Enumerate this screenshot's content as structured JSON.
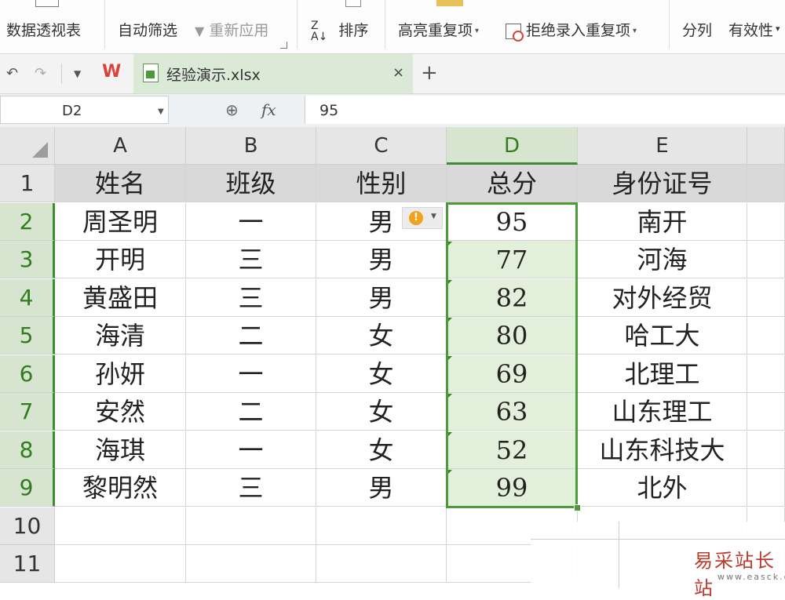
{
  "ribbon": {
    "pivot_table": "数据透视表",
    "autofilter": "自动筛选",
    "reapply": "重新应用",
    "sort": "排序",
    "highlight_dupes": "高亮重复项",
    "reject_dupes": "拒绝录入重复项",
    "split_columns": "分列",
    "validity": "有效性"
  },
  "tabs": [
    {
      "label": "经验演示.xlsx",
      "active": true
    }
  ],
  "formula_bar": {
    "name_box": "D2",
    "fx_label": "fx",
    "content": "95"
  },
  "columns": [
    "A",
    "B",
    "C",
    "D",
    "E"
  ],
  "rows": [
    "1",
    "2",
    "3",
    "4",
    "5",
    "6",
    "7",
    "8",
    "9",
    "10",
    "11"
  ],
  "selected_column": "D",
  "active_cell": "D2",
  "table": {
    "header": [
      "姓名",
      "班级",
      "性别",
      "总分",
      "身份证号"
    ],
    "data": [
      [
        "周圣明",
        "一",
        "男",
        "95",
        "南开"
      ],
      [
        "开明",
        "三",
        "男",
        "77",
        "河海"
      ],
      [
        "黄盛田",
        "三",
        "男",
        "82",
        "对外经贸"
      ],
      [
        "海清",
        "二",
        "女",
        "80",
        "哈工大"
      ],
      [
        "孙妍",
        "一",
        "女",
        "69",
        "北理工"
      ],
      [
        "安然",
        "二",
        "女",
        "63",
        "山东理工"
      ],
      [
        "海琪",
        "一",
        "女",
        "52",
        "山东科技大"
      ],
      [
        "黎明然",
        "三",
        "男",
        "99",
        "北外"
      ]
    ]
  },
  "watermark": {
    "text": "易采站长站",
    "url": "www.easck.com"
  },
  "colors": {
    "accent_green": "#4c9a3a",
    "selection_fill": "#e2efdb",
    "header_fill": "#d9d9d9",
    "warning": "#f2a21b",
    "watermark_red": "#c0392b"
  }
}
